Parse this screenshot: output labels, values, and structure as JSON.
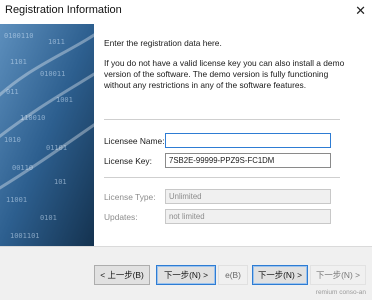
{
  "window": {
    "title": "Registration Information",
    "close_glyph": "✕"
  },
  "content": {
    "intro": "Enter the registration data here.",
    "description": "If you do not have a valid license key you can also install a demo version of the software. The demo version is fully functioning without any restrictions in any of the software features."
  },
  "form": {
    "licensee_label": "Licensee Name:",
    "licensee_value": "",
    "license_key_label": "License Key:",
    "license_key_value": "7SB2E-99999-PPZ9S-FC1DM",
    "license_type_label": "License Type:",
    "license_type_value": "Unlimited",
    "updates_label": "Updates:",
    "updates_value": "not limited"
  },
  "buttons": {
    "back": "< 上一步(B)",
    "next": "下一步(N) >",
    "ghost": "e(B)",
    "next2": "下一步(N) >",
    "ghost2": "下一步(N) >"
  },
  "watermark": "remium conso-an",
  "colors": {
    "banner": "#2f5f8a",
    "focus_border": "#2e7cd3"
  },
  "icons": {
    "close": "close-icon"
  }
}
